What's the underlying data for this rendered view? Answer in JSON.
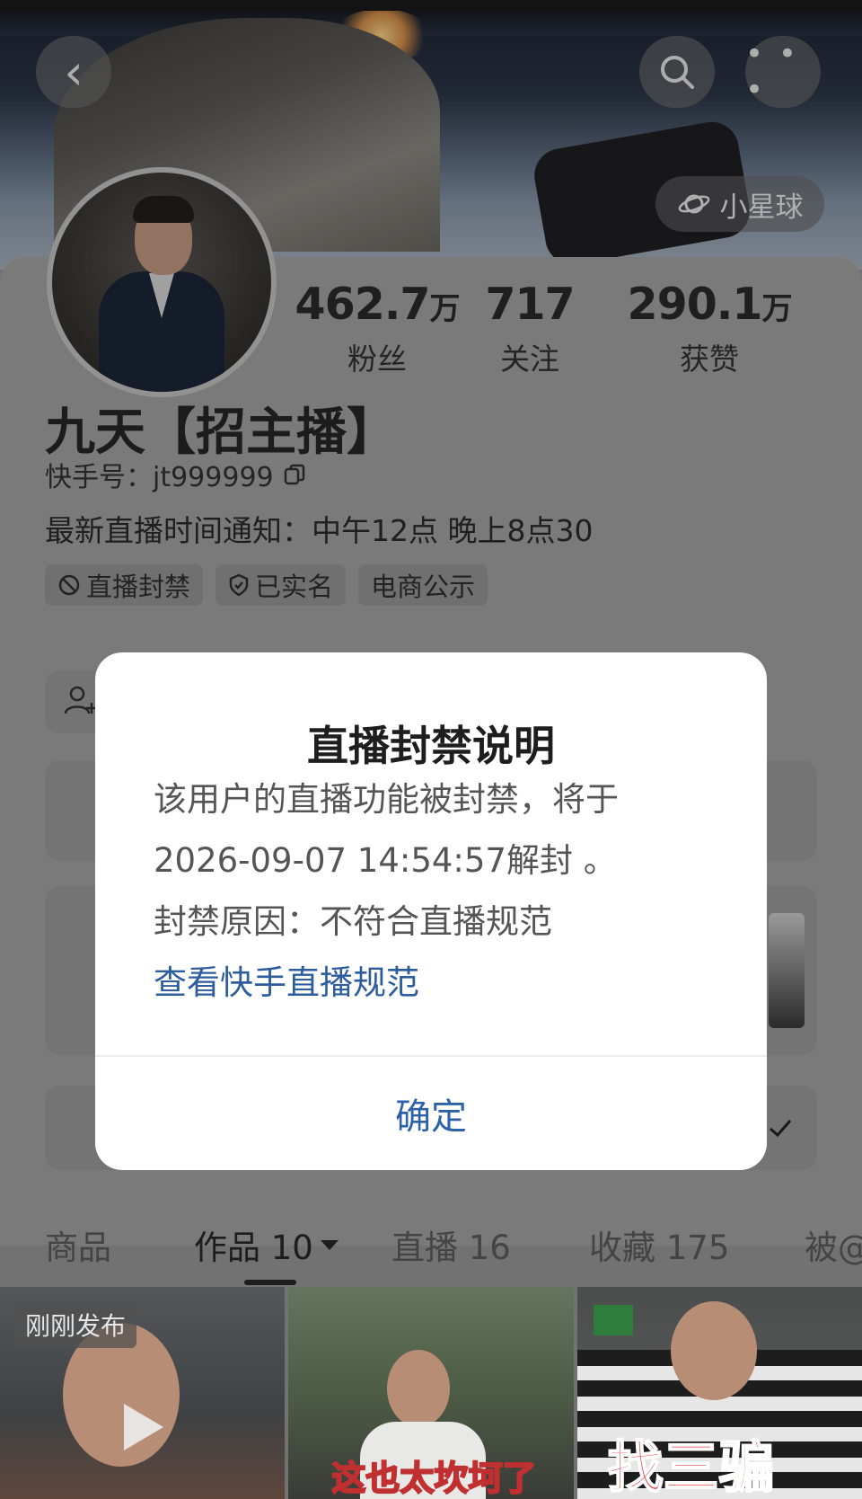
{
  "cover": {
    "planet_label": "小星球",
    "more_label": "• • •"
  },
  "stats": [
    {
      "num": "462.7",
      "unit": "万",
      "label": "粉丝"
    },
    {
      "num": "717",
      "unit": "",
      "label": "关注"
    },
    {
      "num": "290.1",
      "unit": "万",
      "label": "获赞"
    }
  ],
  "profile": {
    "name": "九天【招主播】",
    "uid": "快手号：jt999999",
    "notice": "最新直播时间通知：中午12点 晚上8点30",
    "tags": [
      "直播封禁",
      "已实名",
      "电商公示"
    ]
  },
  "modal": {
    "title": "直播封禁说明",
    "line1": "该用户的直播功能被封禁，将于",
    "line2": "2026-09-07 14:54:57解封 。",
    "line3": "封禁原因：不符合直播规范",
    "link": "查看快手直播规范",
    "confirm": "确定"
  },
  "tabs": [
    "商品",
    "作品 10",
    "直播 16",
    "收藏 175",
    "被@"
  ],
  "thumbs": {
    "badge": "刚刚发布",
    "caption2": "这也太坎坷了",
    "caption3": "找三骗"
  },
  "colors": {
    "accent": "#2e62a8",
    "link": "#2d5d9c"
  }
}
